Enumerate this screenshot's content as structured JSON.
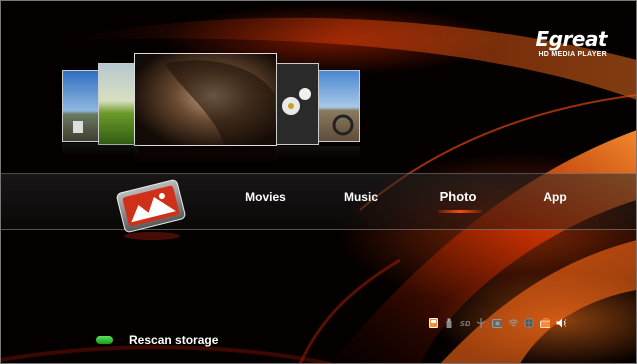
{
  "brand": {
    "name": "Egreat",
    "tagline": "HD MEDIA PLAYER"
  },
  "menu": {
    "items": [
      {
        "label": "Movies",
        "active": false
      },
      {
        "label": "Music",
        "active": false
      },
      {
        "label": "Photo",
        "active": true
      },
      {
        "label": "App",
        "active": false
      }
    ],
    "selected_icon": "photo-app-icon"
  },
  "carousel": {
    "thumbnails": [
      "landscape-person-photo",
      "green-field-photo",
      "woman-portrait-photo",
      "flowers-photo",
      "motorcycle-photo"
    ]
  },
  "status_bar": {
    "icons": [
      "sd-card-icon",
      "usb-stick-icon",
      "sd-card-slot-icon",
      "usb-icon",
      "hdd-icon",
      "wifi-icon",
      "network-globe-icon",
      "ir-remote-icon",
      "volume-icon"
    ]
  },
  "footer": {
    "hint_color": "#2ecc40",
    "hint_label": "Rescan storage"
  },
  "colors": {
    "accent": "#ff4a10",
    "background": "#050000"
  }
}
